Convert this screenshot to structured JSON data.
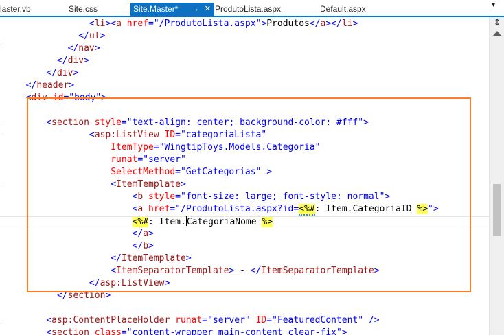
{
  "tabs": [
    {
      "label": "laster.vb",
      "active": false
    },
    {
      "label": "Site.css",
      "active": false
    },
    {
      "label": "Site.Master*",
      "active": true
    },
    {
      "label": "ProdutoLista.aspx",
      "active": false
    },
    {
      "label": "Default.aspx",
      "active": false
    }
  ],
  "tab_pin_icon": "pin-icon",
  "tab_close_icon": "close-icon",
  "overflow_icon": "chevron-down-icon",
  "scrollbar": {
    "split_icon": "split-icon",
    "up_arrow_icon": "arrow-up-icon"
  },
  "colors": {
    "active_tab": "#0e70c0",
    "highlight_box": "#ff7c22",
    "tag": "#a31515",
    "attribute": "#ff0000",
    "value": "#0000ff",
    "server_tag_highlight": "#ffff55"
  },
  "code": {
    "l1": {
      "indent": "            ",
      "p1": "<",
      "tag": "li",
      "p2": "><",
      "tag2": "a",
      "attr": " href",
      "eq": "=",
      "val": "\"/ProdutoLista.aspx\"",
      "p3": ">",
      "text": "Produtos",
      "p4": "</",
      "tag3": "a",
      "p5": "></",
      "tag4": "li",
      "p6": ">"
    },
    "l2": {
      "indent": "          ",
      "p1": "</",
      "tag": "ul",
      "p2": ">"
    },
    "l3": {
      "indent": "        ",
      "p1": "</",
      "tag": "nav",
      "p2": ">"
    },
    "l4": {
      "indent": "      ",
      "p1": "</",
      "tag": "div",
      "p2": ">"
    },
    "l5": {
      "indent": "    ",
      "p1": "</",
      "tag": "div",
      "p2": ">"
    },
    "l6": {
      "indent": "  ",
      "p1": "</",
      "tag": "header",
      "p2": ">"
    },
    "l7": {
      "indent": "  ",
      "p1": "<",
      "tag": "div",
      "attr": " id",
      "eq": "=",
      "val": "\"body\"",
      "p2": ">"
    },
    "l9": {
      "indent": "    ",
      "p1": "<",
      "tag": "section",
      "attr": " style",
      "eq": "=",
      "val": "\"text-align: center; background-color: #fff\"",
      "p2": ">"
    },
    "l10": {
      "indent": "            ",
      "p1": "<",
      "tag": "asp:ListView",
      "attr": " ID",
      "eq": "=",
      "val": "\"categoriaLista\""
    },
    "l11": {
      "indent": "                ",
      "attr": "ItemType",
      "eq": "=",
      "val": "\"WingtipToys.Models.Categoria\""
    },
    "l12": {
      "indent": "                ",
      "attr": "runat",
      "eq": "=",
      "val": "\"server\""
    },
    "l13": {
      "indent": "                ",
      "attr": "SelectMethod",
      "eq": "=",
      "val": "\"GetCategorias\"",
      "p2": " >"
    },
    "l14": {
      "indent": "                ",
      "p1": "<",
      "tag": "ItemTemplate",
      "p2": ">"
    },
    "l15": {
      "indent": "                    ",
      "p1": "<",
      "tag": "b",
      "attr": " style",
      "eq": "=",
      "val": "\"font-size: large; font-style: normal\"",
      "p2": ">"
    },
    "l16": {
      "indent": "                    ",
      "p1": "<",
      "tag": "a",
      "attr": " href",
      "eq": "=",
      "val": "\"/ProdutoLista.aspx?id=",
      "srv_open": "<%#",
      "expr": ": Item.CategoriaID ",
      "srv_close": "%>",
      "val2": "\"",
      "p2": ">"
    },
    "l17": {
      "indent": "                    ",
      "srv_open": "<%#",
      "expr_a": ": Item.",
      "expr_b": "CategoriaNome ",
      "srv_close": "%>"
    },
    "l18": {
      "indent": "                    ",
      "p1": "</",
      "tag": "a",
      "p2": ">"
    },
    "l19": {
      "indent": "                    ",
      "p1": "</",
      "tag": "b",
      "p2": ">"
    },
    "l20": {
      "indent": "                ",
      "p1": "</",
      "tag": "ItemTemplate",
      "p2": ">"
    },
    "l21": {
      "indent": "                ",
      "p1": "<",
      "tag": "ItemSeparatorTemplate",
      "p2": ">",
      "text": " - ",
      "p3": "</",
      "tag2": "ItemSeparatorTemplate",
      "p4": ">"
    },
    "l22": {
      "indent": "            ",
      "p1": "</",
      "tag": "asp:ListView",
      "p2": ">"
    },
    "l23": {
      "indent": "      ",
      "p1": "</",
      "tag": "section",
      "p2": ">"
    },
    "l25": {
      "indent": "    ",
      "p1": "<",
      "tag": "asp:ContentPlaceHolder",
      "attr": " runat",
      "eq": "=",
      "val": "\"server\"",
      "attr2": " ID",
      "eq2": "=",
      "val2": "\"FeaturedContent\"",
      "p2": " />"
    },
    "l26": {
      "indent": "    ",
      "p1": "<",
      "tag": "section",
      "attr": " class",
      "eq": "=",
      "val": "\"content-wrapper main-content clear-fix\"",
      "p2": ">"
    }
  }
}
